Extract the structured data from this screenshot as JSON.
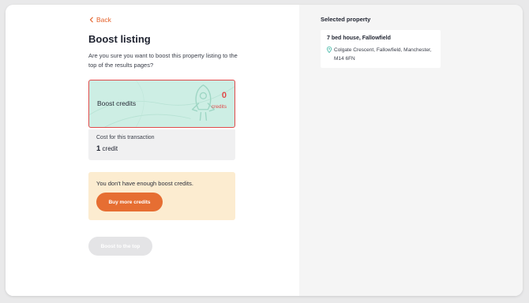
{
  "left": {
    "back_label": "Back",
    "title": "Boost listing",
    "description": "Are you sure you want to boost this property listing to the top of the results pages?",
    "credits_card": {
      "label": "Boost credits",
      "count": "0",
      "unit": "credits"
    },
    "cost": {
      "label": "Cost for this transaction",
      "value": "1",
      "unit": "credit"
    },
    "warning": {
      "text": "You don't have enough boost credits.",
      "button_label": "Buy more credits"
    },
    "boost_button_label": "Boost to the top"
  },
  "right": {
    "heading": "Selected property",
    "property": {
      "name": "7 bed house, Fallowfield",
      "address": "Colgate Crescent, Fallowfield, Manchester, M14 6FN"
    }
  },
  "icons": {
    "back": "chevron-left-icon",
    "location": "location-pin-icon",
    "decoration": "rocket-icon"
  },
  "colors": {
    "accent_orange": "#e66e32",
    "error_red": "#e04a4a",
    "mint": "#cdeee4",
    "warning_bg": "#fcecd0",
    "pin_teal": "#3bb5a3"
  }
}
